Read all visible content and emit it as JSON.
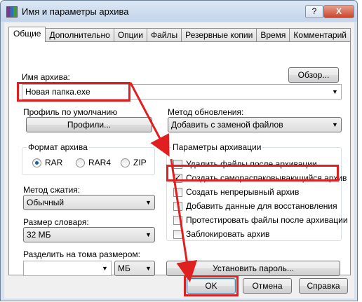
{
  "window": {
    "title": "Имя и параметры архива",
    "help_label": "?",
    "close_label": "X"
  },
  "tabs": [
    "Общие",
    "Дополнительно",
    "Опции",
    "Файлы",
    "Резервные копии",
    "Время",
    "Комментарий"
  ],
  "general": {
    "archive_name_label": "Имя архива:",
    "archive_name_value": "Новая папка.exe",
    "browse_label": "Обзор...",
    "default_profile_label": "Профиль по умолчанию",
    "profiles_button": "Профили...",
    "update_method_label": "Метод обновления:",
    "update_method_value": "Добавить с заменой файлов",
    "archive_format_title": "Формат архива",
    "formats": [
      "RAR",
      "RAR4",
      "ZIP"
    ],
    "selected_format": "RAR",
    "compression_method_label": "Метод сжатия:",
    "compression_method_value": "Обычный",
    "dictionary_size_label": "Размер словаря:",
    "dictionary_size_value": "32 МБ",
    "split_volumes_label": "Разделить на тома размером:",
    "split_volumes_value": "",
    "split_unit_value": "МБ",
    "set_password_button": "Установить пароль...",
    "archiving_params_title": "Параметры архивации",
    "options": [
      {
        "label": "Удалить файлы после архивации",
        "checked": false
      },
      {
        "label": "Создать самораспаковывающийся архив",
        "checked": true
      },
      {
        "label": "Создать непрерывный архив",
        "checked": false
      },
      {
        "label": "Добавить данные для восстановления",
        "checked": false
      },
      {
        "label": "Протестировать файлы после архивации",
        "checked": false
      },
      {
        "label": "Заблокировать архив",
        "checked": false
      }
    ]
  },
  "footer": {
    "ok": "OK",
    "cancel": "Отмена",
    "help": "Справка"
  },
  "annotation_color": "#e02020"
}
